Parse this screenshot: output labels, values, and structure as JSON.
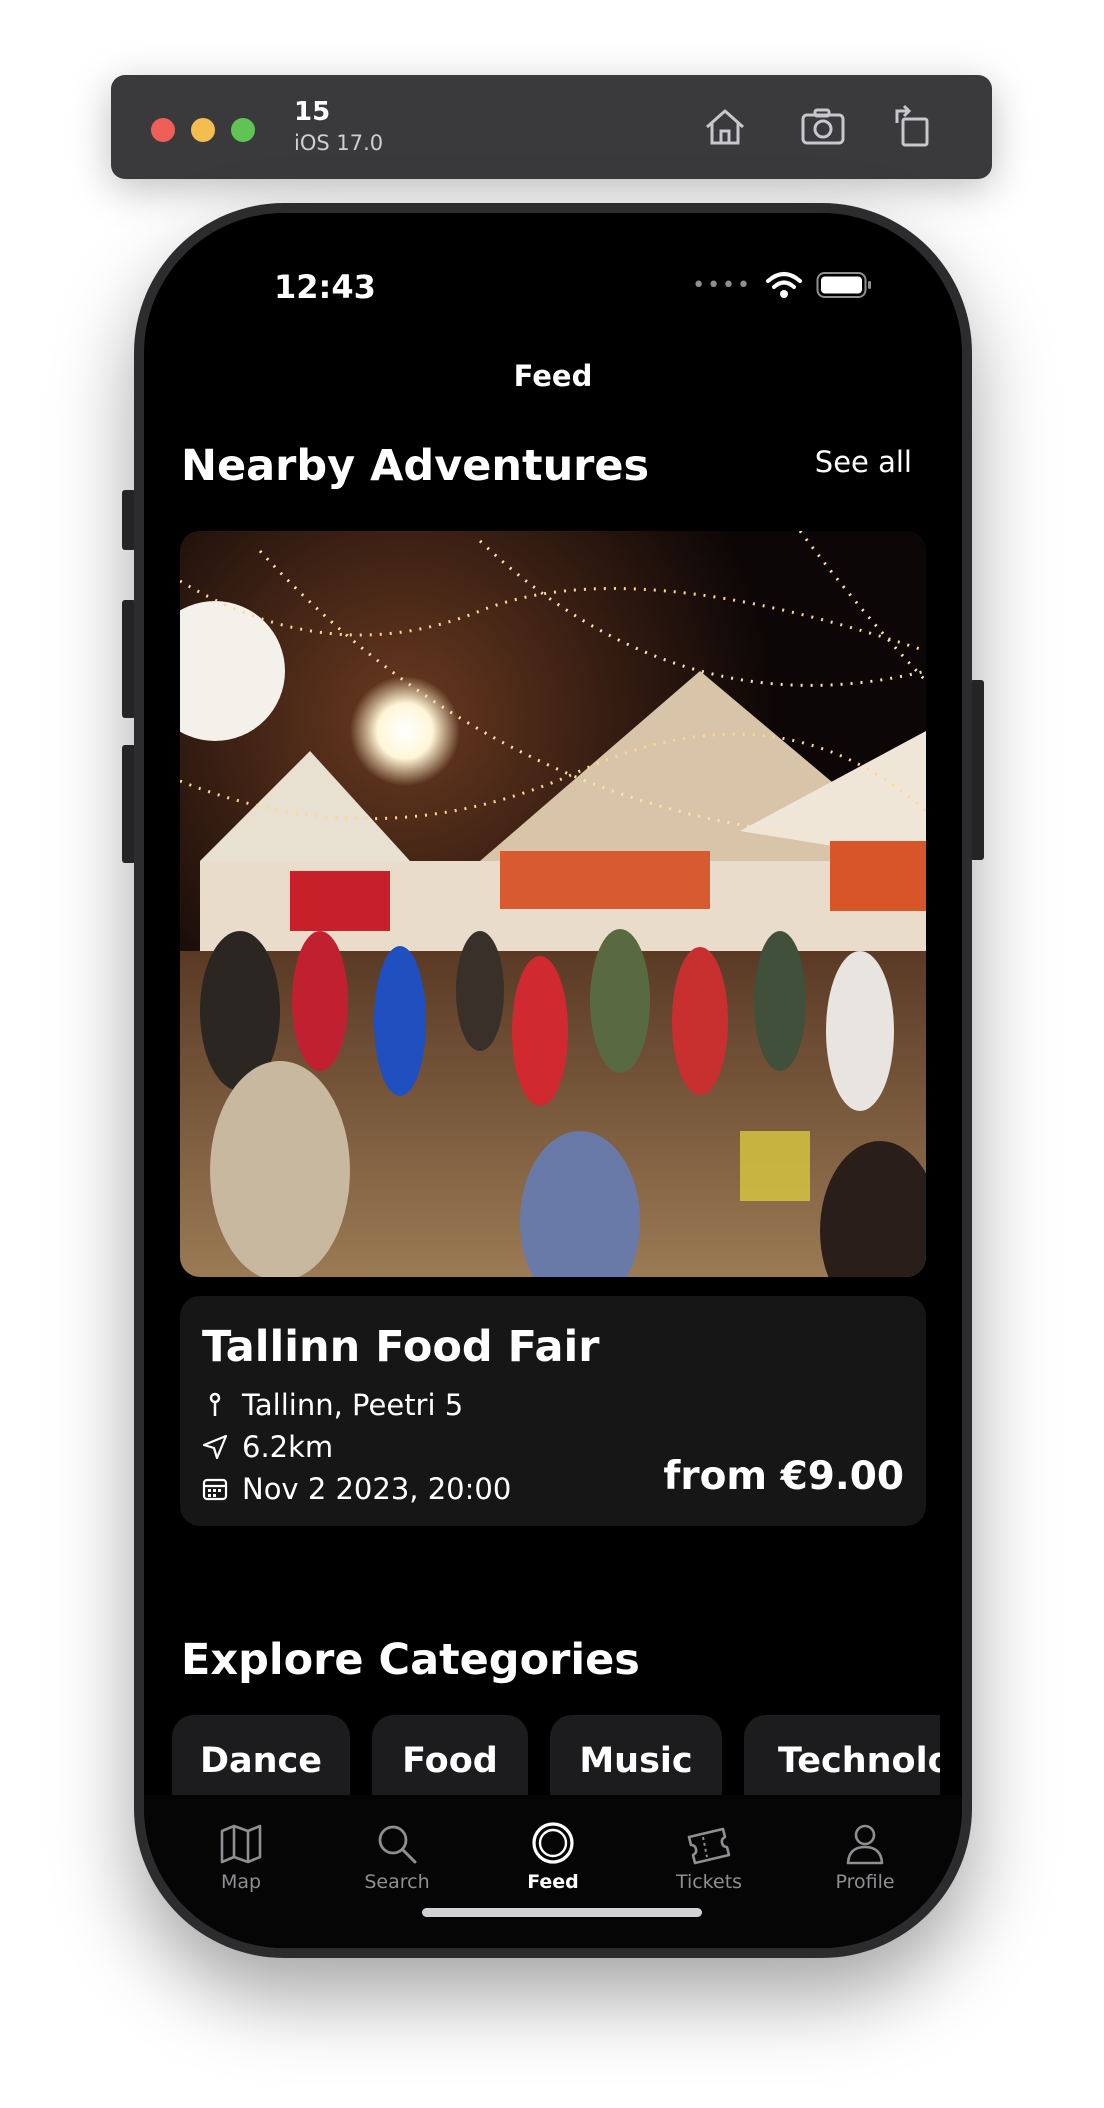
{
  "simulator": {
    "device_name": "15",
    "os_version": "iOS 17.0",
    "buttons": [
      {
        "label": "",
        "icon": "home-icon"
      },
      {
        "label": "",
        "icon": "screenshot-icon"
      },
      {
        "label": "",
        "icon": "rotate-icon"
      }
    ]
  },
  "status_bar": {
    "time": "12:43",
    "wifi_icon": "wifi-icon",
    "battery_icon": "battery-icon"
  },
  "nav": {
    "title": "Feed"
  },
  "nearby": {
    "title": "Nearby Adventures",
    "see_all": "See all"
  },
  "event": {
    "image_description_icon": "event-photo",
    "title": "Tallinn Food Fair",
    "address": "Tallinn, Peetri 5",
    "distance": "6.2km",
    "datetime": "Nov 2 2023, 20:00",
    "price": "from €9.00"
  },
  "categories": {
    "title": "Explore Categories",
    "items": [
      "Dance",
      "Food",
      "Music",
      "Technolo"
    ]
  },
  "tabbar": {
    "items": [
      {
        "label": "Map",
        "icon": "map-icon",
        "active": false
      },
      {
        "label": "Search",
        "icon": "search-icon",
        "active": false
      },
      {
        "label": "Feed",
        "icon": "feed-icon",
        "active": true
      },
      {
        "label": "Tickets",
        "icon": "tickets-icon",
        "active": false
      },
      {
        "label": "Profile",
        "icon": "profile-icon",
        "active": false
      }
    ]
  },
  "colors": {
    "background": "#000000",
    "card": "#161617",
    "inactive_tab": "#8e8e93",
    "active_tab": "#ffffff"
  }
}
